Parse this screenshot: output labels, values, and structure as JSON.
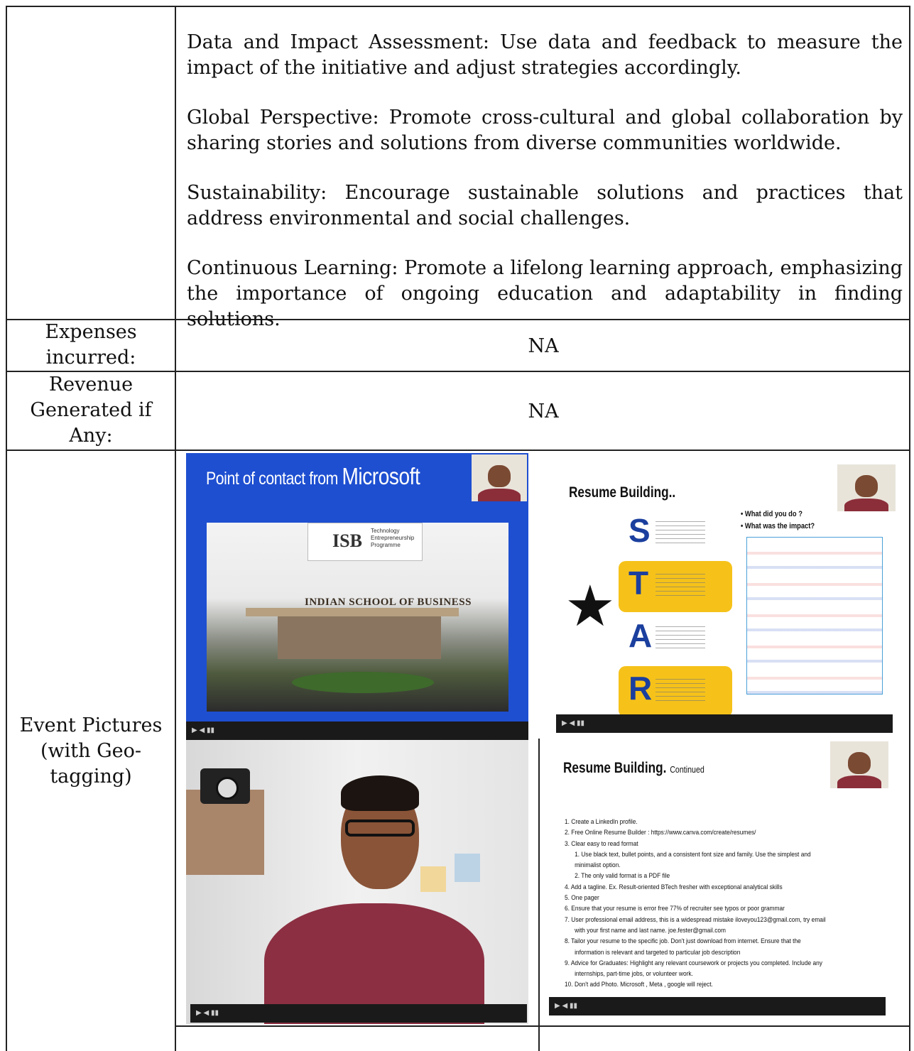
{
  "paragraphs": [
    "Data and Impact Assessment: Use data and feedback to measure the impact of the initiative and adjust strategies accordingly.",
    "Global Perspective: Promote cross-cultural and global collaboration by sharing stories and solutions from diverse communities worldwide.",
    "Sustainability: Encourage sustainable solutions and practices that address environmental and social challenges.",
    "Continuous Learning: Promote a lifelong learning approach, emphasizing the importance of ongoing education and adaptability in finding solutions."
  ],
  "rows": {
    "expenses": {
      "label_line1": "Expenses",
      "label_line2": "incurred:",
      "value": "NA"
    },
    "revenue": {
      "label_line1": "Revenue",
      "label_line2": "Generated if",
      "label_line3": "Any:",
      "value": "NA"
    },
    "pictures": {
      "label_line1": "Event Pictures",
      "label_line2": "(with Geo-",
      "label_line3": "tagging)"
    }
  },
  "photo1": {
    "title_small": "Point of contact from",
    "title_brand": "Microsoft",
    "logo_text": "ISB",
    "logo_sub1": "Technology",
    "logo_sub2": "Entrepreneurship",
    "logo_sub3": "Programme",
    "sign": "INDIAN SCHOOL OF BUSINESS"
  },
  "slide1": {
    "title": "Resume Building..",
    "letters": [
      "S",
      "T",
      "A",
      "R"
    ],
    "bullets": [
      "What did you do ?",
      "What was the impact?"
    ],
    "star_glyph": "★",
    "colors": {
      "highlight": "#f6c21a",
      "letter": "#1b3f9e"
    }
  },
  "slide2": {
    "title": "Resume Building.",
    "title_suffix": "Continued",
    "items": [
      "1.  Create a LinkedIn profile.",
      "2.  Free Online Resume Builder : https://www.canva.com/create/resumes/",
      "3.  Clear easy to read format",
      "1.  Use black text, bullet points, and a consistent font size and family. Use the simplest and",
      "minimalist option.",
      "2.  The only valid format is a PDF file",
      "4.  Add a tagline. Ex. Result-oriented BTech fresher with exceptional analytical skills",
      "5.  One pager",
      "6.  Ensure that your resume is error free 77% of recruiter see typos or poor grammar",
      "7.  User professional email address, this is a widespread mistake iloveyou123@gmail.com, try email",
      "with your first name and last name. joe.fester@gmail.com",
      "8.  Tailor your resume to the specific job. Don't just download from internet. Ensure that the",
      "information is relevant and targeted to particular job description",
      "9.  Advice for Graduates: Highlight any relevant coursework or projects you completed. Include any",
      "internships, part-time jobs, or volunteer work.",
      "10. Don't add Photo. Microsoft , Meta , google will reject."
    ]
  }
}
